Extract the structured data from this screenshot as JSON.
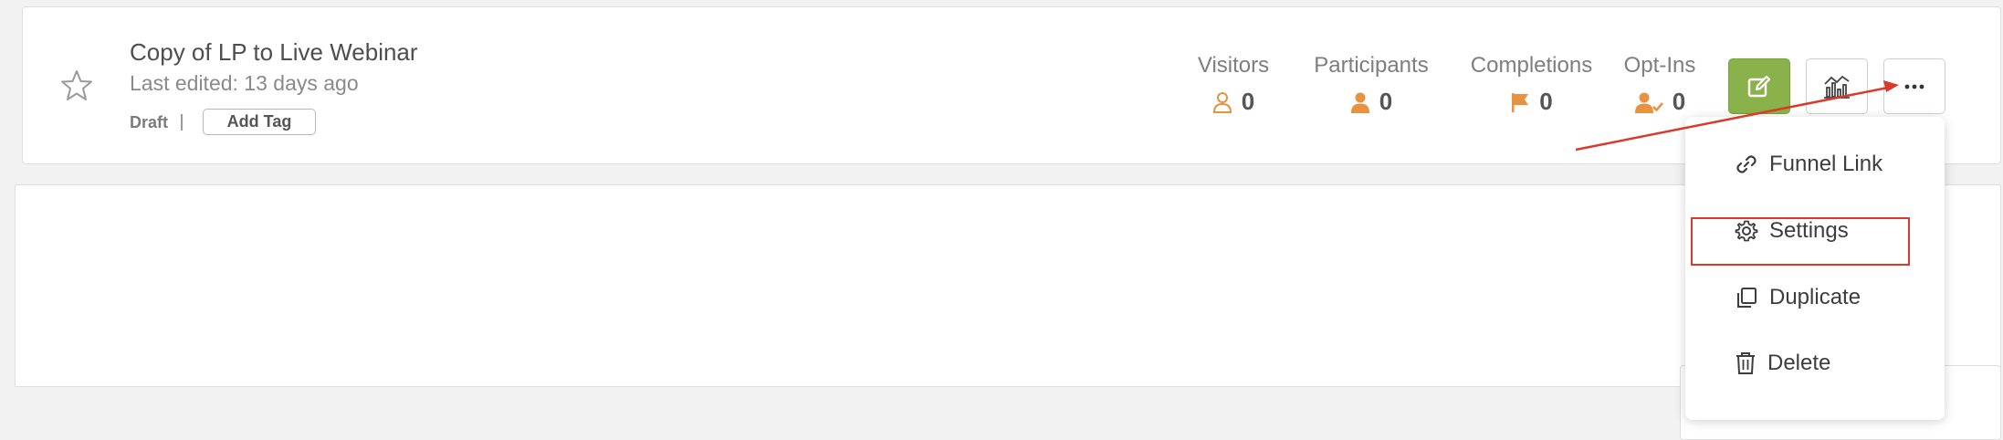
{
  "funnel": {
    "title": "Copy of LP to Live Webinar",
    "last_edited": "Last edited: 13 days ago",
    "status": "Draft",
    "add_tag_label": "Add Tag"
  },
  "stats": [
    {
      "label": "Visitors",
      "value": "0",
      "icon": "user-outline-icon"
    },
    {
      "label": "Participants",
      "value": "0",
      "icon": "user-filled-icon"
    },
    {
      "label": "Completions",
      "value": "0",
      "icon": "flag-icon"
    },
    {
      "label": "Opt-Ins",
      "value": "0",
      "icon": "user-check-icon"
    }
  ],
  "actions": {
    "edit_icon": "edit-icon",
    "analytics_icon": "analytics-icon",
    "more_icon": "more-icon",
    "edit_color": "#8ab24a"
  },
  "menu": {
    "items": [
      {
        "label": "Funnel Link",
        "icon": "link-icon"
      },
      {
        "label": "Settings",
        "icon": "gear-icon"
      },
      {
        "label": "Duplicate",
        "icon": "copy-icon"
      },
      {
        "label": "Delete",
        "icon": "trash-icon"
      }
    ]
  },
  "colors": {
    "stat_icon": "#e8913f",
    "annotation": "#d93a2b"
  }
}
